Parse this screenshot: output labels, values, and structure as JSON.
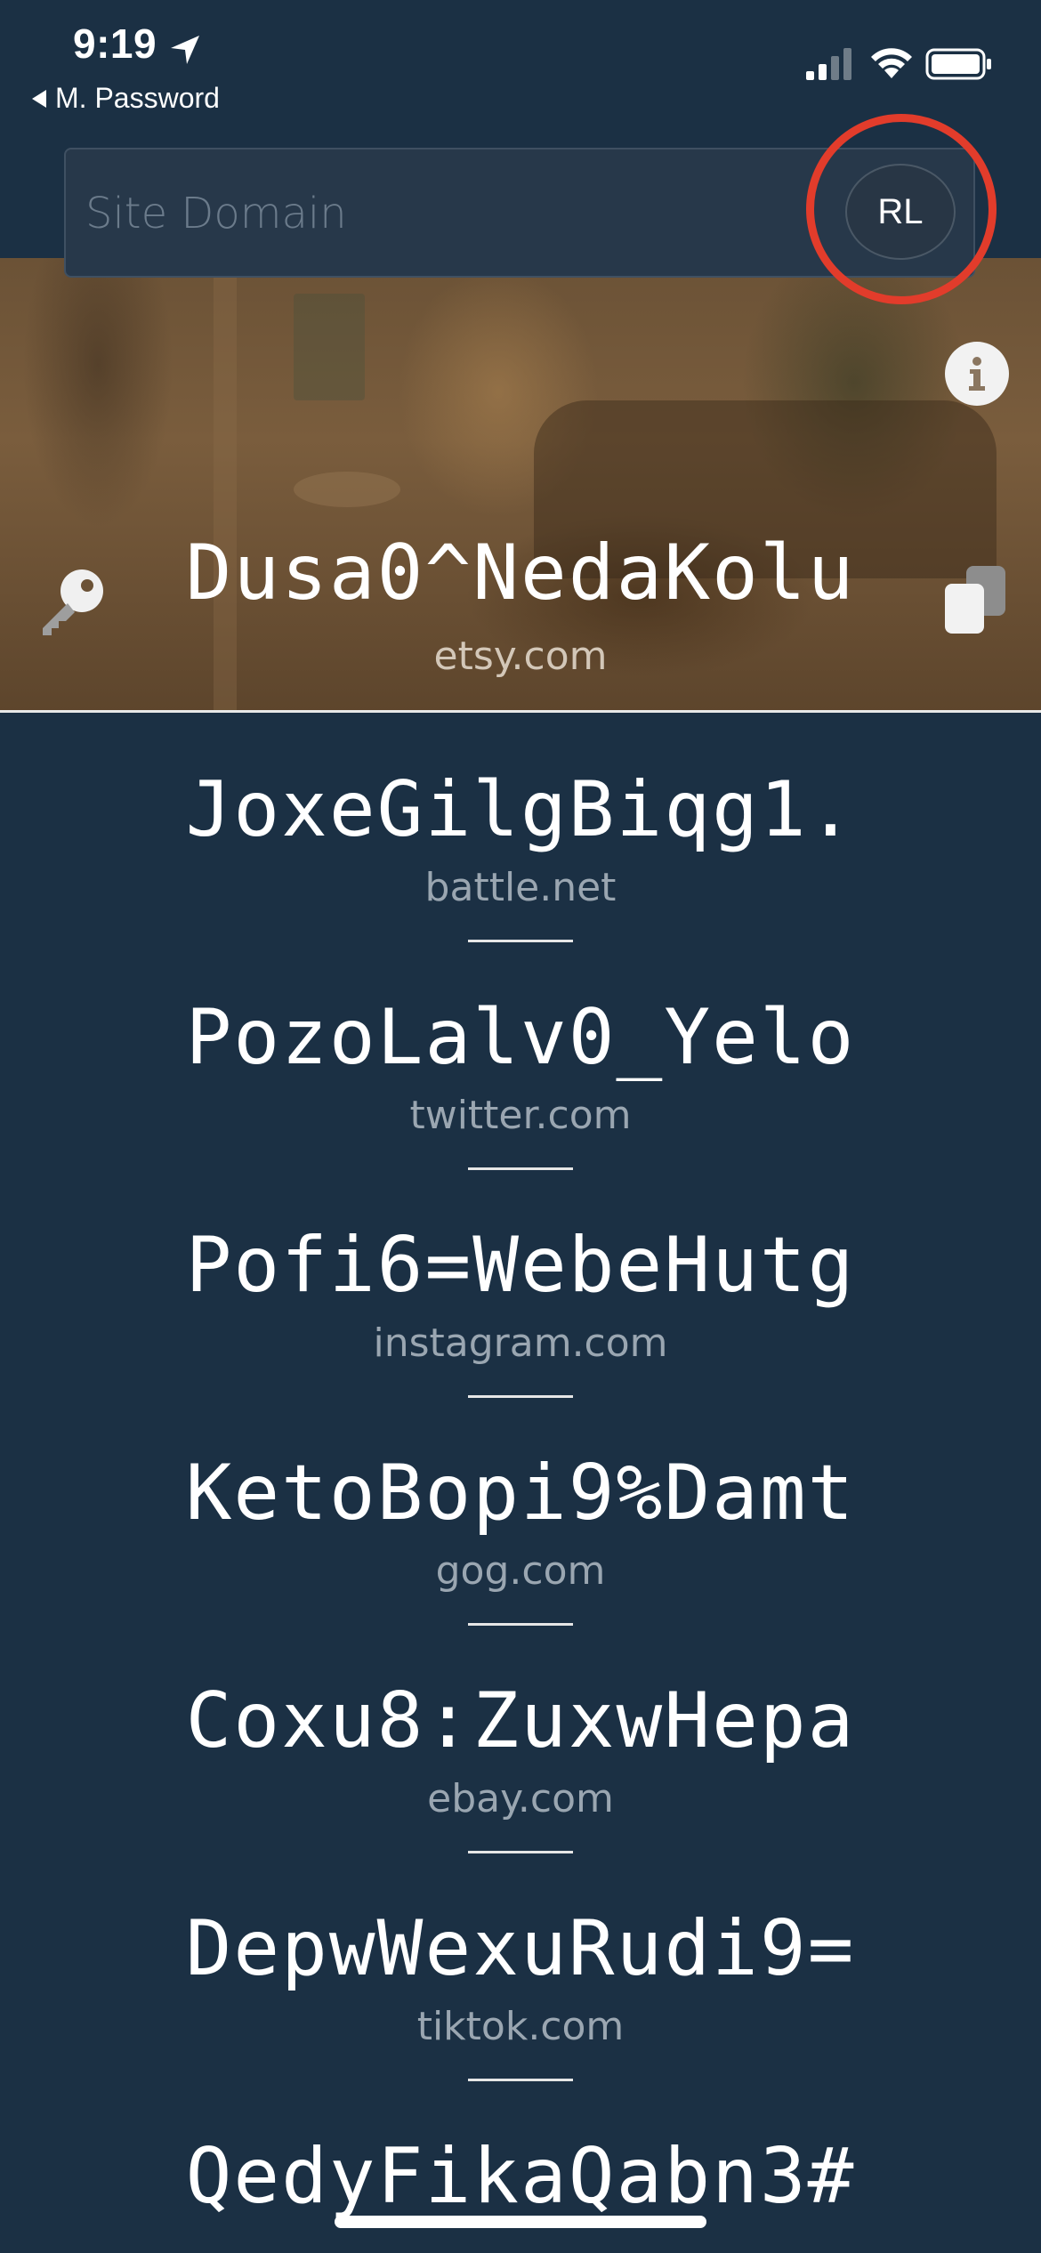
{
  "status_bar": {
    "time": "9:19",
    "back_app_label": "M. Password"
  },
  "search": {
    "placeholder": "Site Domain",
    "value": "",
    "avatar_initials": "RL"
  },
  "selected": {
    "password": "Dusa0^NedaKolu",
    "site": "etsy.com"
  },
  "list": [
    {
      "password": "JoxeGilgBiqg1.",
      "site": "battle.net"
    },
    {
      "password": "PozoLalv0_Yelo",
      "site": "twitter.com"
    },
    {
      "password": "Pofi6=WebeHutg",
      "site": "instagram.com"
    },
    {
      "password": "KetoBopi9%Damt",
      "site": "gog.com"
    },
    {
      "password": "Coxu8:ZuxwHepa",
      "site": "ebay.com"
    },
    {
      "password": "DepwWexuRudi9=",
      "site": "tiktok.com"
    },
    {
      "password": "QedyFikaQabn3#",
      "site": ""
    }
  ],
  "colors": {
    "background": "#1b3044",
    "highlight_ring": "#e23c2b",
    "separator": "#e6e6e6"
  },
  "icons": {
    "location": "location-arrow-icon",
    "signal": "cellular-signal-icon",
    "wifi": "wifi-icon",
    "battery": "battery-icon",
    "info": "info-icon",
    "key": "key-icon",
    "copy": "copy-icon"
  }
}
